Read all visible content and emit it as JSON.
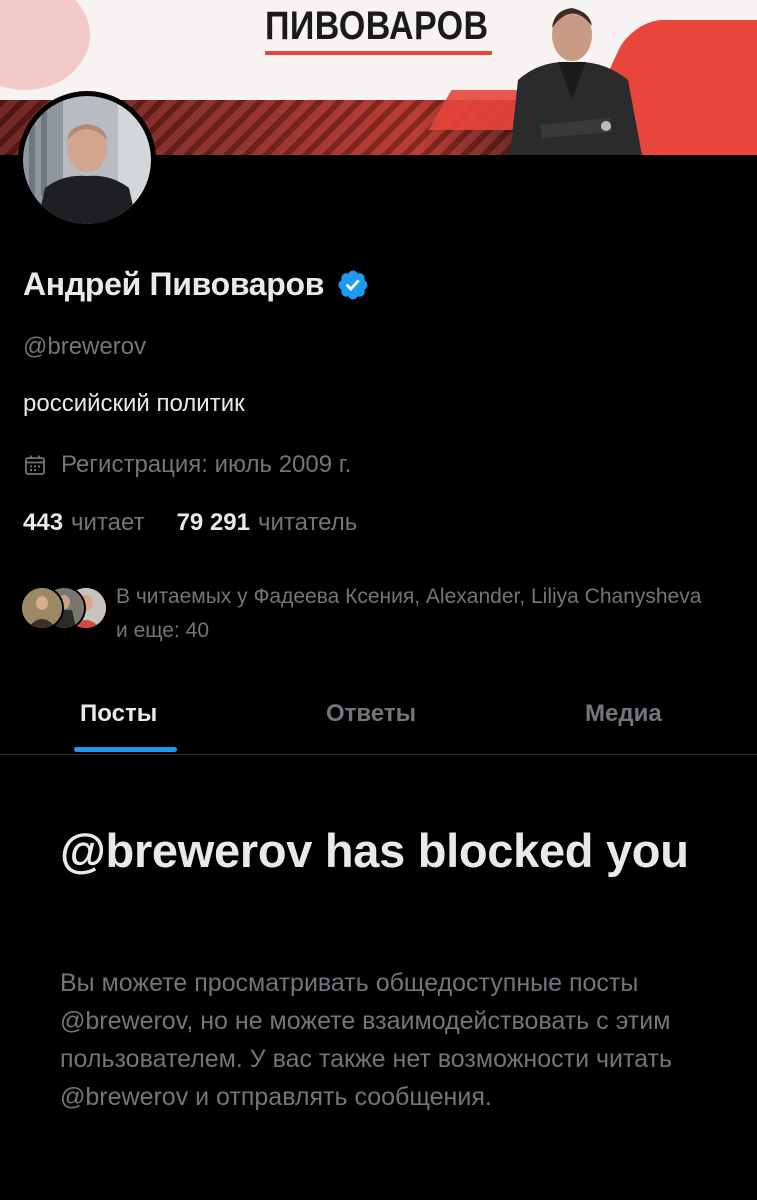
{
  "banner": {
    "title": "ПИВОВАРОВ"
  },
  "profile": {
    "name": "Андрей Пивоваров",
    "handle": "@brewerov",
    "bio": "российский политик",
    "joined": "Регистрация: июль 2009 г.",
    "following_count": "443",
    "following_label": "читает",
    "followers_count": "79 291",
    "followers_label": "читатель",
    "known_followers": "В читаемых у Фадеева Ксения, Alexander, Liliya Chanysheva и еще: 40"
  },
  "tabs": [
    {
      "label": "Посты",
      "active": true
    },
    {
      "label": "Ответы",
      "active": false
    },
    {
      "label": "Медиа",
      "active": false
    }
  ],
  "blocked": {
    "title": "@brewerov has blocked you",
    "description": "Вы можете просматривать общедоступные посты @brewerov, но не можете взаимодействовать с этим пользователем. У вас также нет возможности читать @brewerov и отправлять сообщения."
  },
  "colors": {
    "background": "#000000",
    "accent": "#1d9bf0",
    "muted_text": "#71767b",
    "primary_text": "#e7e9ea",
    "banner_red": "#e8453c"
  },
  "icons": [
    "verified-badge-icon",
    "calendar-icon"
  ]
}
